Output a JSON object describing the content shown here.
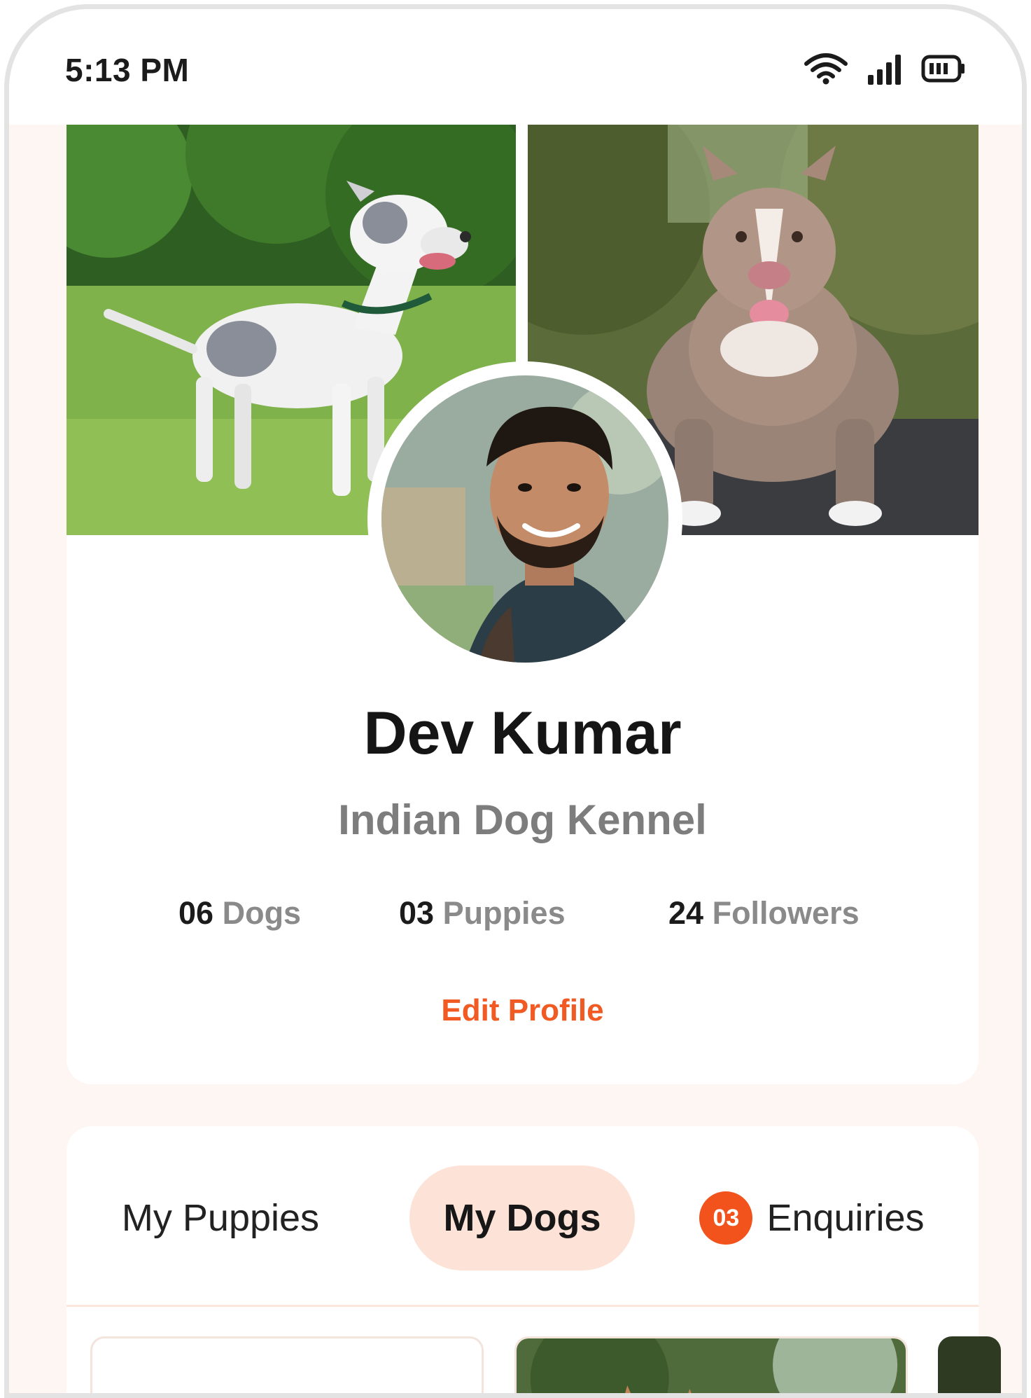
{
  "status_bar": {
    "time": "5:13 PM",
    "icons": [
      "wifi-icon",
      "signal-icon",
      "battery-icon"
    ]
  },
  "profile": {
    "name": "Dev Kumar",
    "kennel": "Indian Dog Kennel",
    "stats": [
      {
        "count": "06",
        "label": "Dogs"
      },
      {
        "count": "03",
        "label": "Puppies"
      },
      {
        "count": "24",
        "label": "Followers"
      }
    ],
    "edit_label": "Edit Profile"
  },
  "tabs": [
    {
      "label": "My Puppies",
      "active": false
    },
    {
      "label": "My Dogs",
      "active": true
    },
    {
      "label": "Enquiries",
      "badge": "03",
      "active": false
    }
  ],
  "colors": {
    "accent": "#f15a22",
    "active_tab_bg": "#fde3d7",
    "page_bg": "#fdf6f2"
  }
}
